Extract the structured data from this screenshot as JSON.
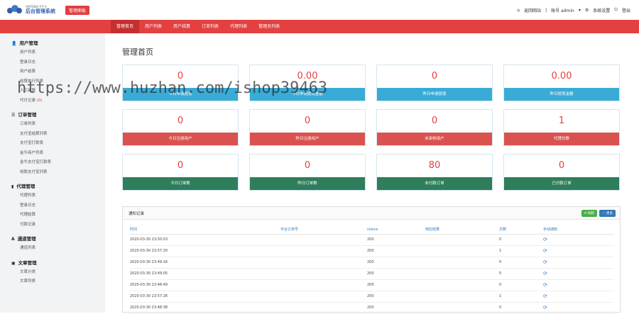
{
  "header": {
    "logo_small": "ANTONIA P P A",
    "logo_title": "后台管理系统",
    "badge": "管理面板",
    "back_site": "返回网站",
    "account": "账号 admin",
    "settings": "系统设置",
    "logout": "登出"
  },
  "nav": {
    "tabs": [
      "管理首页",
      "用户列表",
      "用户结算",
      "订单列表",
      "代理列表",
      "管理员列表"
    ]
  },
  "sidebar": {
    "sections": [
      {
        "title": "用户管理",
        "icon": "user-icon",
        "items": [
          "用户列表",
          "登录日志",
          "用户结算",
          "结算执行列表",
          "人工结算",
          "代付记录"
        ],
        "badge": "(0)"
      },
      {
        "title": "订单管理",
        "icon": "list-icon",
        "items": [
          "订单列表",
          "支付宝结算列表",
          "支付宝打款表",
          "金牛商户列表",
          "金牛支付宝打款表",
          "收款支付宝列表"
        ]
      },
      {
        "title": "代理管理",
        "icon": "file-icon",
        "items": [
          "代理列表",
          "登录日志",
          "代理结算",
          "付款记录"
        ]
      },
      {
        "title": "通道管理",
        "icon": "font-icon",
        "items": [
          "通道列表"
        ]
      },
      {
        "title": "文章管理",
        "icon": "book-icon",
        "items": [
          "文章分类",
          "文章列表"
        ]
      }
    ]
  },
  "main": {
    "title": "管理首页",
    "cards": [
      {
        "value": "0",
        "label": "今日申请提现",
        "color": "#3aabd6"
      },
      {
        "value": "0.00",
        "label": "今日申请提现金额",
        "color": "#3aabd6"
      },
      {
        "value": "0",
        "label": "昨日申请提现",
        "color": "#3aabd6"
      },
      {
        "value": "0.00",
        "label": "昨日提现金额",
        "color": "#3aabd6"
      },
      {
        "value": "0",
        "label": "今日注册用户",
        "color": "#da5250"
      },
      {
        "value": "0",
        "label": "昨日注册用户",
        "color": "#da5250"
      },
      {
        "value": "0",
        "label": "未审核用户",
        "color": "#da5250"
      },
      {
        "value": "1",
        "label": "代理总数",
        "color": "#da5250"
      },
      {
        "value": "0",
        "label": "今日订单数",
        "color": "#2e7d5b"
      },
      {
        "value": "0",
        "label": "昨日订单数",
        "color": "#2e7d5b"
      },
      {
        "value": "80",
        "label": "未付款订单",
        "color": "#2e7d5b"
      },
      {
        "value": "0",
        "label": "已付款订单",
        "color": "#2e7d5b"
      }
    ],
    "panel": {
      "title": "通知记录",
      "refresh_btn": "刷新",
      "more_btn": "更多",
      "columns": [
        "时间",
        "平台订单号",
        "status",
        "响应结果",
        "次数",
        "手动通知"
      ],
      "rows": [
        {
          "time": "2020-03-30 23:50:03",
          "order": "",
          "status": "200",
          "resp": "",
          "count": "0"
        },
        {
          "time": "2020-03-30 23:57:20",
          "order": "",
          "status": "200",
          "resp": "",
          "count": "1"
        },
        {
          "time": "2020-03-30 23:49:16",
          "order": "",
          "status": "200",
          "resp": "",
          "count": "0"
        },
        {
          "time": "2020-03-30 23:49:05",
          "order": "",
          "status": "200",
          "resp": "",
          "count": "0"
        },
        {
          "time": "2020-03-30 23:48:49",
          "order": "",
          "status": "200",
          "resp": "",
          "count": "0"
        },
        {
          "time": "2020-03-30 23:57:26",
          "order": "",
          "status": "200",
          "resp": "",
          "count": "1"
        },
        {
          "time": "2020-03-30 23:48:38",
          "order": "",
          "status": "200",
          "resp": "",
          "count": "0"
        }
      ]
    }
  },
  "watermark": "https://www.huzhan.com/ishop39463"
}
